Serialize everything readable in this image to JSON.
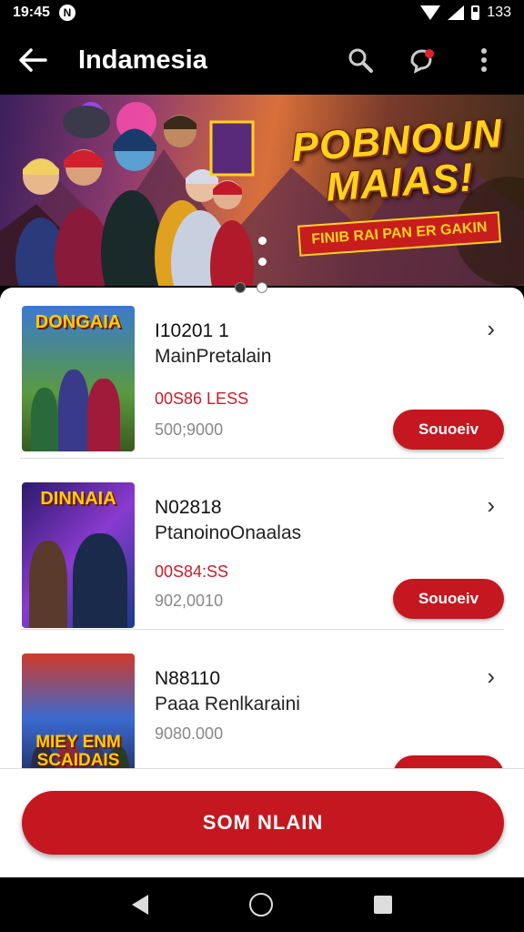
{
  "status_bar": {
    "time": "19:45",
    "nfc_glyph": "N",
    "battery_text": "133"
  },
  "app_bar": {
    "back_icon": "arrow-left-icon",
    "title": "Indamesia",
    "icons": [
      "search-icon",
      "notification-icon",
      "more-vert-icon"
    ],
    "notification_dot_color": "#e0202a"
  },
  "banner": {
    "title_line1": "POBNOUN",
    "title_line2": "MAIAS!",
    "ribbon": "FINIB RAI PAN ER GAKIN"
  },
  "items": [
    {
      "thumb_title": "DONGAIA",
      "code": "I10201 1",
      "name": "MainPretalain",
      "price": "00S86 LESS",
      "sub": "500;9000",
      "button": "Souoeiv"
    },
    {
      "thumb_title": "DINNAIA",
      "code": "N02818",
      "name": "PtanoinoOnaalas",
      "price": "00S84:SS",
      "sub": "902,0010",
      "button": "Souoeiv"
    },
    {
      "thumb_title": "MIEY ENM SCAIDAIS",
      "code": "N88110",
      "name": "Paaa Renlkaraini",
      "price": "",
      "sub": "9080.000",
      "button": ""
    }
  ],
  "bottom_button": "SOM NLAIN",
  "colors": {
    "accent": "#c4171f",
    "price": "#c81d2a"
  }
}
